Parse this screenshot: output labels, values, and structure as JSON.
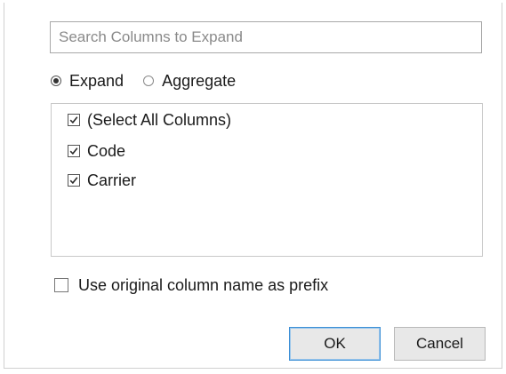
{
  "search": {
    "placeholder": "Search Columns to Expand",
    "value": ""
  },
  "mode": {
    "options": [
      {
        "label": "Expand",
        "selected": true
      },
      {
        "label": "Aggregate",
        "selected": false
      }
    ]
  },
  "columns": {
    "items": [
      {
        "label": "(Select All Columns)",
        "checked": true
      },
      {
        "label": "Code",
        "checked": true
      },
      {
        "label": "Carrier",
        "checked": true
      }
    ]
  },
  "prefix_option": {
    "label": "Use original column name as prefix",
    "checked": false
  },
  "buttons": {
    "ok_label": "OK",
    "cancel_label": "Cancel"
  },
  "icons": {
    "check": "check-icon"
  },
  "colors": {
    "ok_border": "#3c8fd6",
    "button_bg": "#e8e8e8"
  }
}
